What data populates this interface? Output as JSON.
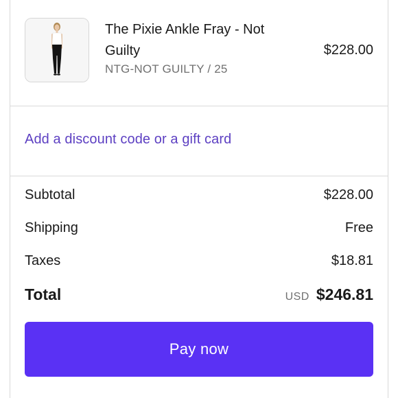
{
  "product": {
    "name": "The Pixie Ankle Fray - Not Guilty",
    "variant": "NTG-NOT GUILTY / 25",
    "price": "$228.00",
    "image_icon": "model-wearing-black-jeans"
  },
  "discount": {
    "link_text": "Add a discount code or a gift card"
  },
  "summary": {
    "subtotal_label": "Subtotal",
    "subtotal_value": "$228.00",
    "shipping_label": "Shipping",
    "shipping_value": "Free",
    "taxes_label": "Taxes",
    "taxes_value": "$18.81",
    "total_label": "Total",
    "total_currency": "USD",
    "total_value": "$246.81"
  },
  "pay": {
    "label": "Pay now"
  },
  "colors": {
    "accent": "#5a31f4",
    "link": "#5c3fc2",
    "muted": "#707070",
    "divider": "#d9d9d9"
  }
}
